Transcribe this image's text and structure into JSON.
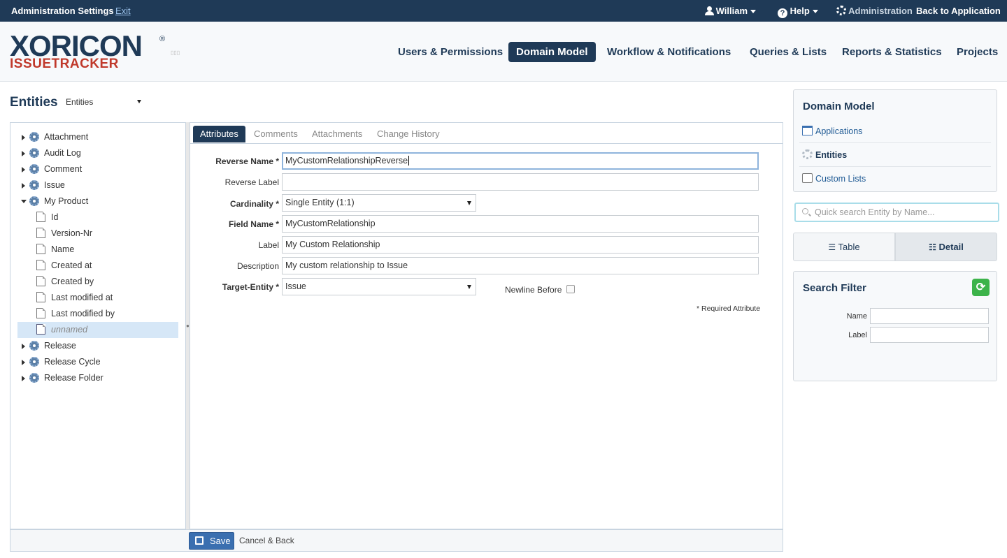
{
  "topbar": {
    "title": "Administration Settings",
    "exit": "Exit",
    "user": "William",
    "help": "Help",
    "admin_label": "Administration",
    "back": "Back to Application"
  },
  "logo": {
    "main": "XORICON",
    "sub": "ISSUETRACKER"
  },
  "nav": [
    "Users & Permissions",
    "Domain Model",
    "Workflow & Notifications",
    "Queries & Lists",
    "Reports & Statistics",
    "Projects"
  ],
  "nav_active": "Domain Model",
  "page": {
    "title": "Entities",
    "selector": "Entities"
  },
  "tree": {
    "items": [
      "Attachment",
      "Audit Log",
      "Comment",
      "Issue",
      "My Product",
      "Release",
      "Release Cycle",
      "Release Folder"
    ],
    "children": [
      "Id",
      "Version-Nr",
      "Name",
      "Created at",
      "Created by",
      "Last modified at",
      "Last modified by",
      "unnamed"
    ]
  },
  "tabs": [
    "Attributes",
    "Comments",
    "Attachments",
    "Change History"
  ],
  "form": {
    "reverse_name_label": "Reverse Name *",
    "reverse_name": "MyCustomRelationshipReverse",
    "reverse_label_label": "Reverse Label",
    "reverse_label": "",
    "cardinality_label": "Cardinality *",
    "cardinality": "Single Entity (1:1)",
    "field_name_label": "Field Name *",
    "field_name": "MyCustomRelationship",
    "label_label": "Label",
    "label": "My Custom Relationship",
    "description_label": "Description",
    "description": "My custom relationship to Issue",
    "target_label": "Target-Entity *",
    "target": "Issue",
    "newline_label": "Newline Before",
    "required_note": "* Required Attribute"
  },
  "footer": {
    "save": "Save",
    "cancel": "Cancel & Back"
  },
  "sidebar": {
    "title": "Domain Model",
    "links": [
      "Applications",
      "Entities",
      "Custom Lists"
    ],
    "search_placeholder": "Quick search Entity by Name...",
    "view_table": "Table",
    "view_detail": "Detail",
    "filter_title": "Search Filter",
    "filter_name": "Name",
    "filter_label": "Label"
  },
  "colors": {
    "brand": "#1f3a57",
    "accent": "#c0392b",
    "link": "#1f5a94",
    "refresh": "#3cb34a"
  }
}
